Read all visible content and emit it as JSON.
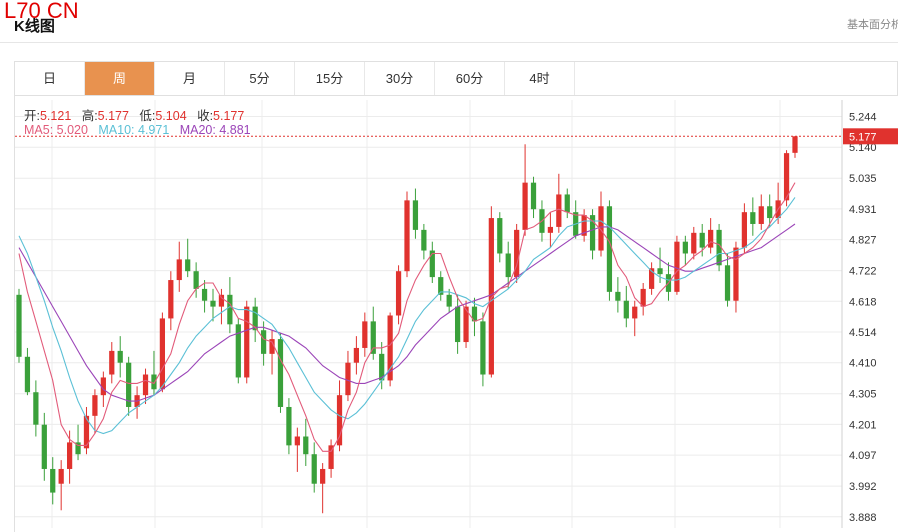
{
  "header": {
    "symbol": "L70 CN",
    "title": "K线图",
    "right_link": "基本面分析"
  },
  "tabs": [
    {
      "label": "日",
      "active": false
    },
    {
      "label": "周",
      "active": true
    },
    {
      "label": "月",
      "active": false
    },
    {
      "label": "5分",
      "active": false
    },
    {
      "label": "15分",
      "active": false
    },
    {
      "label": "30分",
      "active": false
    },
    {
      "label": "60分",
      "active": false
    },
    {
      "label": "4时",
      "active": false
    }
  ],
  "info": {
    "open_label": "开:",
    "open": "5.121",
    "high_label": "高:",
    "high": "5.177",
    "low_label": "低:",
    "low": "5.104",
    "close_label": "收:",
    "close": "5.177",
    "ma5_label": "MA5:",
    "ma5": "5.020",
    "ma10_label": "MA10:",
    "ma10": "4.971",
    "ma20_label": "MA20:",
    "ma20": "4.881"
  },
  "colors": {
    "up": "#e0322e",
    "down": "#3aa03a",
    "ma5": "#e25b7a",
    "ma10": "#5bc0d6",
    "ma20": "#9b45b8",
    "last_price_bg": "#e0322e",
    "grid": "#ececec"
  },
  "chart_data": {
    "type": "candlestick",
    "ylim": [
      3.85,
      5.3
    ],
    "y_ticks": [
      "5.244",
      "5.140",
      "5.035",
      "4.931",
      "4.827",
      "4.722",
      "4.618",
      "4.514",
      "4.410",
      "4.305",
      "4.201",
      "4.097",
      "3.992",
      "3.888"
    ],
    "last_price_label": "5.177",
    "grid": true,
    "series": [
      {
        "name": "MA5"
      },
      {
        "name": "MA10"
      },
      {
        "name": "MA20"
      }
    ],
    "ohlc": [
      [
        4.64,
        4.66,
        4.41,
        4.43
      ],
      [
        4.43,
        4.46,
        4.3,
        4.31
      ],
      [
        4.31,
        4.35,
        4.16,
        4.2
      ],
      [
        4.2,
        4.24,
        4.01,
        4.05
      ],
      [
        4.05,
        4.09,
        3.93,
        3.97
      ],
      [
        4.0,
        4.08,
        3.91,
        4.05
      ],
      [
        4.05,
        4.18,
        4.0,
        4.14
      ],
      [
        4.14,
        4.2,
        4.08,
        4.1
      ],
      [
        4.12,
        4.26,
        4.1,
        4.23
      ],
      [
        4.23,
        4.32,
        4.17,
        4.3
      ],
      [
        4.3,
        4.38,
        4.26,
        4.36
      ],
      [
        4.37,
        4.48,
        4.34,
        4.45
      ],
      [
        4.45,
        4.5,
        4.36,
        4.41
      ],
      [
        4.41,
        4.43,
        4.23,
        4.26
      ],
      [
        4.26,
        4.33,
        4.22,
        4.3
      ],
      [
        4.3,
        4.39,
        4.27,
        4.37
      ],
      [
        4.37,
        4.45,
        4.3,
        4.32
      ],
      [
        4.32,
        4.58,
        4.31,
        4.56
      ],
      [
        4.56,
        4.72,
        4.52,
        4.69
      ],
      [
        4.69,
        4.82,
        4.65,
        4.76
      ],
      [
        4.76,
        4.83,
        4.7,
        4.72
      ],
      [
        4.72,
        4.75,
        4.63,
        4.66
      ],
      [
        4.66,
        4.69,
        4.58,
        4.62
      ],
      [
        4.62,
        4.66,
        4.55,
        4.6
      ],
      [
        4.6,
        4.66,
        4.54,
        4.64
      ],
      [
        4.64,
        4.7,
        4.51,
        4.54
      ],
      [
        4.54,
        4.56,
        4.34,
        4.36
      ],
      [
        4.36,
        4.62,
        4.34,
        4.6
      ],
      [
        4.6,
        4.63,
        4.48,
        4.52
      ],
      [
        4.52,
        4.55,
        4.4,
        4.44
      ],
      [
        4.44,
        4.52,
        4.37,
        4.49
      ],
      [
        4.49,
        4.51,
        4.24,
        4.26
      ],
      [
        4.26,
        4.29,
        4.1,
        4.13
      ],
      [
        4.13,
        4.19,
        4.04,
        4.16
      ],
      [
        4.16,
        4.22,
        4.06,
        4.1
      ],
      [
        4.1,
        4.14,
        3.97,
        4.0
      ],
      [
        4.0,
        4.07,
        3.9,
        4.05
      ],
      [
        4.05,
        4.15,
        4.02,
        4.13
      ],
      [
        4.13,
        4.35,
        4.11,
        4.3
      ],
      [
        4.3,
        4.45,
        4.28,
        4.41
      ],
      [
        4.41,
        4.5,
        4.37,
        4.46
      ],
      [
        4.46,
        4.58,
        4.43,
        4.55
      ],
      [
        4.55,
        4.6,
        4.42,
        4.44
      ],
      [
        4.44,
        4.48,
        4.32,
        4.35
      ],
      [
        4.35,
        4.58,
        4.33,
        4.57
      ],
      [
        4.57,
        4.74,
        4.54,
        4.72
      ],
      [
        4.72,
        4.99,
        4.7,
        4.96
      ],
      [
        4.96,
        5.0,
        4.83,
        4.86
      ],
      [
        4.86,
        4.88,
        4.76,
        4.79
      ],
      [
        4.79,
        4.82,
        4.68,
        4.7
      ],
      [
        4.7,
        4.72,
        4.62,
        4.64
      ],
      [
        4.64,
        4.66,
        4.58,
        4.6
      ],
      [
        4.6,
        4.64,
        4.44,
        4.48
      ],
      [
        4.48,
        4.62,
        4.46,
        4.6
      ],
      [
        4.6,
        4.63,
        4.5,
        4.55
      ],
      [
        4.55,
        4.58,
        4.33,
        4.37
      ],
      [
        4.37,
        4.94,
        4.36,
        4.9
      ],
      [
        4.9,
        4.92,
        4.75,
        4.78
      ],
      [
        4.78,
        4.82,
        4.66,
        4.7
      ],
      [
        4.7,
        4.88,
        4.68,
        4.86
      ],
      [
        4.86,
        5.15,
        4.84,
        5.02
      ],
      [
        5.02,
        5.04,
        4.9,
        4.93
      ],
      [
        4.93,
        4.96,
        4.82,
        4.85
      ],
      [
        4.85,
        4.92,
        4.8,
        4.87
      ],
      [
        4.87,
        5.05,
        4.85,
        4.98
      ],
      [
        4.98,
        5.0,
        4.9,
        4.92
      ],
      [
        4.92,
        4.96,
        4.83,
        4.84
      ],
      [
        4.84,
        4.93,
        4.82,
        4.91
      ],
      [
        4.91,
        4.93,
        4.76,
        4.79
      ],
      [
        4.79,
        4.99,
        4.77,
        4.94
      ],
      [
        4.94,
        4.96,
        4.62,
        4.65
      ],
      [
        4.65,
        4.7,
        4.58,
        4.62
      ],
      [
        4.62,
        4.67,
        4.53,
        4.56
      ],
      [
        4.56,
        4.62,
        4.5,
        4.6
      ],
      [
        4.6,
        4.68,
        4.57,
        4.66
      ],
      [
        4.66,
        4.75,
        4.64,
        4.73
      ],
      [
        4.73,
        4.8,
        4.68,
        4.71
      ],
      [
        4.71,
        4.75,
        4.62,
        4.65
      ],
      [
        4.65,
        4.84,
        4.64,
        4.82
      ],
      [
        4.82,
        4.84,
        4.74,
        4.78
      ],
      [
        4.78,
        4.87,
        4.76,
        4.85
      ],
      [
        4.85,
        4.88,
        4.77,
        4.8
      ],
      [
        4.8,
        4.9,
        4.78,
        4.86
      ],
      [
        4.86,
        4.88,
        4.72,
        4.74
      ],
      [
        4.74,
        4.78,
        4.6,
        4.62
      ],
      [
        4.62,
        4.82,
        4.58,
        4.8
      ],
      [
        4.8,
        4.95,
        4.78,
        4.92
      ],
      [
        4.92,
        4.97,
        4.84,
        4.88
      ],
      [
        4.88,
        4.98,
        4.86,
        4.94
      ],
      [
        4.94,
        4.98,
        4.87,
        4.9
      ],
      [
        4.9,
        5.02,
        4.88,
        4.96
      ],
      [
        4.96,
        5.13,
        4.94,
        5.12
      ],
      [
        5.121,
        5.177,
        5.104,
        5.177
      ]
    ],
    "ma5": [
      4.78,
      4.65,
      4.55,
      4.45,
      4.35,
      4.2,
      4.15,
      4.13,
      4.13,
      4.17,
      4.22,
      4.31,
      4.35,
      4.34,
      4.34,
      4.35,
      4.34,
      4.39,
      4.44,
      4.54,
      4.62,
      4.66,
      4.68,
      4.68,
      4.63,
      4.61,
      4.56,
      4.55,
      4.53,
      4.49,
      4.48,
      4.42,
      4.37,
      4.3,
      4.23,
      4.15,
      4.11,
      4.11,
      4.16,
      4.25,
      4.31,
      4.41,
      4.46,
      4.46,
      4.47,
      4.51,
      4.62,
      4.69,
      4.74,
      4.78,
      4.78,
      4.7,
      4.63,
      4.59,
      4.55,
      4.56,
      4.63,
      4.66,
      4.67,
      4.74,
      4.86,
      4.87,
      4.89,
      4.92,
      4.93,
      4.92,
      4.91,
      4.91,
      4.89,
      4.86,
      4.82,
      4.74,
      4.7,
      4.63,
      4.6,
      4.61,
      4.65,
      4.68,
      4.72,
      4.74,
      4.77,
      4.79,
      4.82,
      4.81,
      4.77,
      4.76,
      4.78,
      4.8,
      4.83,
      4.88,
      4.93,
      4.97,
      5.02
    ],
    "ma10": [
      4.84,
      4.78,
      4.7,
      4.62,
      4.53,
      4.45,
      4.36,
      4.28,
      4.22,
      4.18,
      4.17,
      4.18,
      4.21,
      4.24,
      4.26,
      4.28,
      4.3,
      4.33,
      4.37,
      4.41,
      4.46,
      4.5,
      4.53,
      4.56,
      4.58,
      4.6,
      4.59,
      4.59,
      4.58,
      4.56,
      4.54,
      4.5,
      4.46,
      4.41,
      4.36,
      4.31,
      4.28,
      4.25,
      4.23,
      4.22,
      4.24,
      4.27,
      4.31,
      4.35,
      4.39,
      4.43,
      4.49,
      4.55,
      4.59,
      4.62,
      4.65,
      4.65,
      4.64,
      4.63,
      4.61,
      4.6,
      4.62,
      4.64,
      4.66,
      4.69,
      4.72,
      4.76,
      4.78,
      4.8,
      4.84,
      4.87,
      4.88,
      4.89,
      4.89,
      4.89,
      4.87,
      4.84,
      4.81,
      4.78,
      4.75,
      4.72,
      4.7,
      4.69,
      4.69,
      4.7,
      4.72,
      4.74,
      4.76,
      4.78,
      4.78,
      4.79,
      4.8,
      4.82,
      4.85,
      4.87,
      4.9,
      4.93,
      4.97
    ],
    "ma20": [
      4.8,
      4.75,
      4.7,
      4.65,
      4.6,
      4.55,
      4.5,
      4.45,
      4.4,
      4.36,
      4.32,
      4.3,
      4.29,
      4.28,
      4.28,
      4.29,
      4.3,
      4.32,
      4.34,
      4.36,
      4.38,
      4.41,
      4.44,
      4.46,
      4.48,
      4.5,
      4.51,
      4.52,
      4.53,
      4.53,
      4.52,
      4.51,
      4.5,
      4.48,
      4.46,
      4.43,
      4.4,
      4.38,
      4.36,
      4.35,
      4.34,
      4.34,
      4.35,
      4.36,
      4.38,
      4.4,
      4.43,
      4.47,
      4.5,
      4.53,
      4.56,
      4.58,
      4.6,
      4.61,
      4.62,
      4.63,
      4.64,
      4.66,
      4.68,
      4.7,
      4.72,
      4.74,
      4.76,
      4.78,
      4.8,
      4.82,
      4.84,
      4.85,
      4.86,
      4.87,
      4.87,
      4.86,
      4.84,
      4.82,
      4.8,
      4.78,
      4.76,
      4.74,
      4.73,
      4.72,
      4.72,
      4.73,
      4.74,
      4.75,
      4.76,
      4.77,
      4.78,
      4.79,
      4.8,
      4.82,
      4.84,
      4.86,
      4.88
    ]
  }
}
